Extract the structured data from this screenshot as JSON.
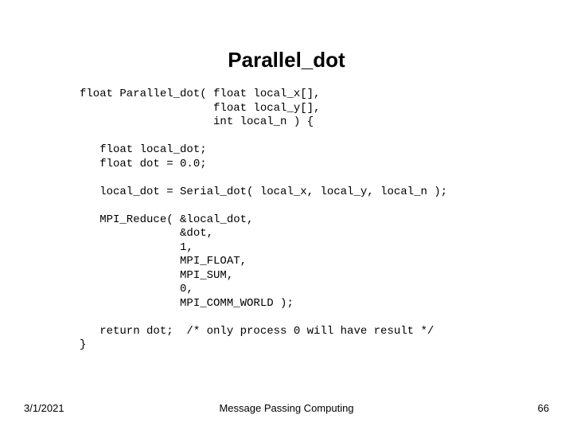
{
  "title": "Parallel_dot",
  "code": "float Parallel_dot( float local_x[],\n                    float local_y[],\n                    int local_n ) {\n\n   float local_dot;\n   float dot = 0.0;\n\n   local_dot = Serial_dot( local_x, local_y, local_n );\n\n   MPI_Reduce( &local_dot,\n               &dot,\n               1,\n               MPI_FLOAT,\n               MPI_SUM,\n               0,\n               MPI_COMM_WORLD );\n\n   return dot;  /* only process 0 will have result */\n}",
  "footer": {
    "date": "3/1/2021",
    "center": "Message Passing Computing",
    "page": "66"
  }
}
